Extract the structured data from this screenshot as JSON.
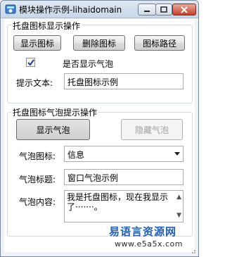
{
  "window": {
    "title": "模块操作示例-lihaidomain"
  },
  "group1": {
    "legend": "托盘图标显示操作",
    "btn_show_icon": "显示图标",
    "btn_delete_icon": "删除图标",
    "btn_icon_path": "图标路径",
    "checkbox_label": "是否显示气泡",
    "checkbox_checked": true,
    "tip_label": "提示文本:",
    "tip_value": "托盘图标示例"
  },
  "group2": {
    "legend": "托盘图标气泡提示操作",
    "btn_show_bubble": "显示气泡",
    "btn_hide_bubble": "隐藏气泡",
    "icon_label": "气泡图标:",
    "icon_value": "信息",
    "title_label": "气泡标题:",
    "title_value": "窗口气泡示例",
    "content_label": "气泡内容:",
    "content_line1": "我是托盘图标，现在我显示",
    "content_line2": "了·······。"
  },
  "watermark": {
    "line1": "易语言资源网",
    "line2": "www.e5a5x.com"
  }
}
